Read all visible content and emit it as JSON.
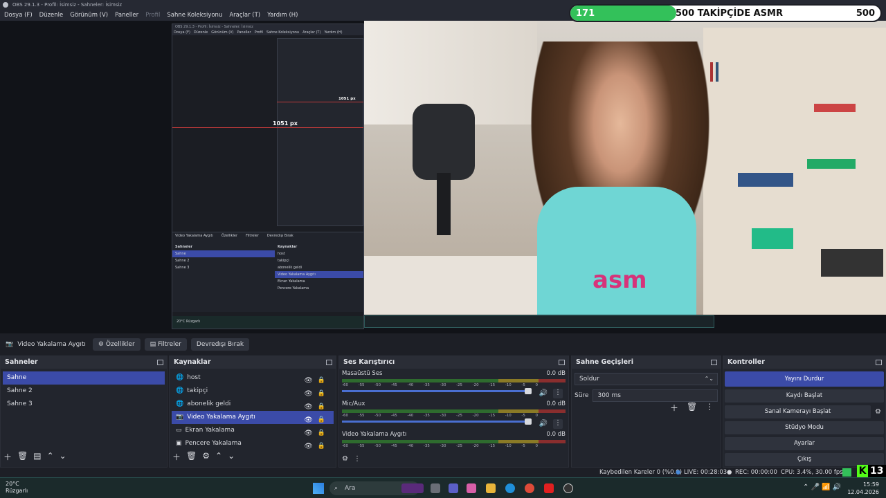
{
  "window": {
    "title": "OBS 29.1.3 - Profil: İsimsiz - Sahneler: İsimsiz"
  },
  "menu": {
    "items": [
      "Dosya (F)",
      "Düzenle",
      "Görünüm (V)",
      "Paneller",
      "Profil",
      "Sahne Koleksiyonu",
      "Araçlar (T)",
      "Yardım (H)"
    ]
  },
  "nested": {
    "title": "OBS 29.1.3 - Profil: İsimsiz - Sahneler: İsimsiz",
    "px_label_main": "1051 px",
    "px_label_inner": "1051 px",
    "source_label": "Video Yakalama Aygıtı",
    "props": "Özellikler",
    "filters": "Filtreler",
    "deact": "Devredışı Bırak",
    "scenes_head": "Sahneler",
    "sources_head": "Kaynaklar",
    "scenes": [
      "Sahne",
      "Sahne 2",
      "Sahne 3"
    ],
    "sources": [
      "host",
      "takipçi",
      "abonelik geldi",
      "Video Yakalama Aygıtı",
      "Ekran Yakalama",
      "Pencere Yakalama"
    ],
    "weather": "20°C Rüzgarlı"
  },
  "follower": {
    "current": "171",
    "label": "500 TAKİPÇİDE ASMR",
    "goal": "500",
    "progress": 0.342
  },
  "camera": {
    "shirt_text": "asm"
  },
  "source_bar": {
    "label": "Video Yakalama Aygıtı",
    "properties": "Özellikler",
    "filters": "Filtreler",
    "deactivate": "Devredışı Bırak"
  },
  "scenes": {
    "title": "Sahneler",
    "items": [
      "Sahne",
      "Sahne 2",
      "Sahne 3"
    ],
    "selected": 0
  },
  "sources": {
    "title": "Kaynaklar",
    "items": [
      {
        "name": "host",
        "icon": "globe-icon"
      },
      {
        "name": "takipçi",
        "icon": "globe-icon"
      },
      {
        "name": "abonelik geldi",
        "icon": "globe-icon"
      },
      {
        "name": "Video Yakalama Aygıtı",
        "icon": "camera-icon"
      },
      {
        "name": "Ekran Yakalama",
        "icon": "monitor-icon"
      },
      {
        "name": "Pencere Yakalama",
        "icon": "window-icon"
      }
    ],
    "selected": 3
  },
  "mixer": {
    "title": "Ses Karıştırıcı",
    "channels": [
      {
        "name": "Masaüstü Ses",
        "db": "0.0 dB"
      },
      {
        "name": "Mic/Aux",
        "db": "0.0 dB"
      },
      {
        "name": "Video Yakalama Aygıtı",
        "db": "0.0 dB"
      }
    ],
    "ticks": [
      "-60",
      "-55",
      "-50",
      "-45",
      "-40",
      "-35",
      "-30",
      "-25",
      "-20",
      "-15",
      "-10",
      "-5",
      "0"
    ]
  },
  "transitions": {
    "title": "Sahne Geçişleri",
    "selected": "Soldur",
    "duration_label": "Süre",
    "duration": "300 ms"
  },
  "controls": {
    "title": "Kontroller",
    "buttons": [
      "Yayını Durdur",
      "Kaydı Başlat",
      "Sanal Kamerayı Başlat",
      "Stüdyo Modu",
      "Ayarlar",
      "Çıkış"
    ]
  },
  "status": {
    "dropped": "Kaybedilen Kareler 0 (%0.0)",
    "live": "LIVE: 00:28:03",
    "rec": "REC: 00:00:00",
    "cpu": "CPU: 3.4%, 30.00 fps"
  },
  "kick": {
    "count": "13",
    "logo": "K"
  },
  "taskbar": {
    "temp": "20°C",
    "weather": "Rüzgarlı",
    "search": "Ara",
    "time": "15:59",
    "date": "12.04.2026"
  }
}
